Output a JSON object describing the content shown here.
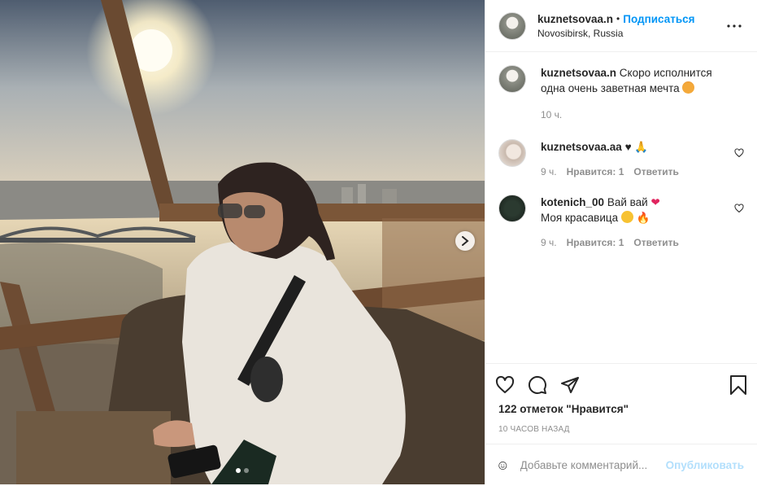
{
  "header": {
    "username": "kuznetsovaa.n",
    "separator": "•",
    "follow_label": "Подписаться",
    "location": "Novosibirsk, Russia"
  },
  "caption": {
    "username": "kuznetsovaa.n",
    "text": "Скоро исполнится одна очень заветная мечта",
    "time": "10 ч."
  },
  "comments": [
    {
      "username": "kuznetsovaa.aa",
      "text": "♥",
      "time": "9 ч.",
      "likes": "Нравится: 1",
      "reply": "Ответить"
    },
    {
      "username": "kotenich_00",
      "text": "Вай вай",
      "text2": "Моя красавица",
      "time": "9 ч.",
      "likes": "Нравится: 1",
      "reply": "Ответить"
    }
  ],
  "likes_text": "122 отметок \"Нравится\"",
  "post_time": "10 ЧАСОВ НАЗАД",
  "add_comment": {
    "placeholder": "Добавьте комментарий...",
    "publish_label": "Опубликовать"
  },
  "carousel": {
    "total": 2,
    "current": 1
  },
  "colors": {
    "accent": "#0095f6",
    "publish_disabled": "#b2dffc",
    "muted": "#8e8e8e",
    "text": "#262626"
  },
  "icons": [
    "chevron-right-icon",
    "more-icon",
    "heart-icon",
    "comment-icon",
    "share-icon",
    "bookmark-icon",
    "smiley-icon"
  ]
}
